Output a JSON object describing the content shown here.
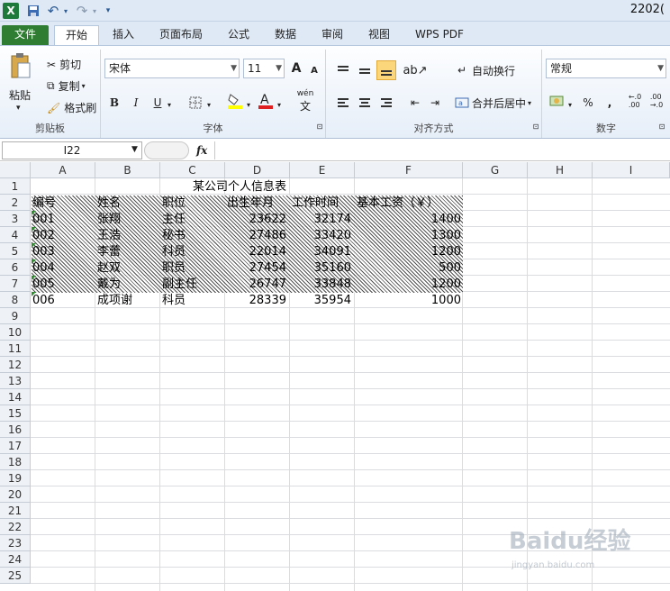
{
  "titlebar": {
    "title": "2202(",
    "undo": "↶",
    "redo": "↷"
  },
  "tabs": [
    "文件",
    "开始",
    "插入",
    "页面布局",
    "公式",
    "数据",
    "审阅",
    "视图",
    "WPS PDF"
  ],
  "ribbon": {
    "clipboard": {
      "title": "剪贴板",
      "paste": "粘贴",
      "cut": "剪切",
      "copy": "复制",
      "format_painter": "格式刷"
    },
    "font": {
      "title": "字体",
      "family": "宋体",
      "size": "11",
      "bold": "B",
      "italic": "I",
      "underline": "U",
      "grow": "A",
      "shrink": "A",
      "phonetic": "wén"
    },
    "alignment": {
      "title": "对齐方式",
      "wrap": "自动换行",
      "merge": "合并后居中"
    },
    "number": {
      "title": "数字",
      "format": "常规",
      "percent": "%",
      "comma": ","
    }
  },
  "formula": {
    "namebox": "I22",
    "fx": "fx",
    "content": ""
  },
  "columns": [
    "A",
    "B",
    "C",
    "D",
    "E",
    "F",
    "G",
    "H",
    "I"
  ],
  "rows": [
    "1",
    "2",
    "3",
    "4",
    "5",
    "6",
    "7",
    "8",
    "9",
    "10",
    "11",
    "12",
    "13",
    "14",
    "15",
    "16",
    "17",
    "18",
    "19",
    "20",
    "21",
    "22",
    "23",
    "24",
    "25"
  ],
  "sheet": {
    "title": "某公司个人信息表",
    "headers": [
      "编号",
      "姓名",
      "职位",
      "出生年月",
      "工作时间",
      "基本工资（￥）"
    ],
    "data": [
      [
        "001",
        "张翔",
        "主任",
        "23622",
        "32174",
        "1400"
      ],
      [
        "002",
        "王浩",
        "秘书",
        "27486",
        "33420",
        "1300"
      ],
      [
        "003",
        "李蕾",
        "科员",
        "22014",
        "34091",
        "1200"
      ],
      [
        "004",
        "赵双",
        "职员",
        "27454",
        "35160",
        "500"
      ],
      [
        "005",
        "戴为",
        "副主任",
        "26747",
        "33848",
        "1200"
      ],
      [
        "006",
        "成项谢",
        "科员",
        "28339",
        "35954",
        "1000"
      ]
    ]
  },
  "watermark": {
    "main": "Baidu经验",
    "sub": "jingyan.baidu.com"
  }
}
